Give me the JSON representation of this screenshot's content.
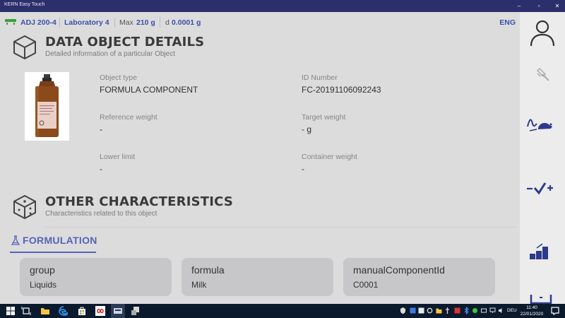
{
  "window": {
    "title": "KERN Easy Touch",
    "minimize": "–",
    "maximize": "▫",
    "close": "✕"
  },
  "status": {
    "balance": "ADJ 200-4",
    "lab": "Laboratory 4",
    "max_label": "Max",
    "max_value": "210 g",
    "d_label": "d",
    "d_value": "0.0001 g",
    "language": "ENG"
  },
  "details": {
    "title": "DATA OBJECT DETAILS",
    "subtitle": "Detailed information of a particular Object",
    "fields": [
      {
        "label": "Object type",
        "value": "FORMULA COMPONENT"
      },
      {
        "label": "ID Number",
        "value": "FC-20191106092243"
      },
      {
        "label": "Reference weight",
        "value": "-"
      },
      {
        "label": "Target weight",
        "value": "- g"
      },
      {
        "label": "Lower limit",
        "value": "-"
      },
      {
        "label": "Container weight",
        "value": "-"
      }
    ]
  },
  "other": {
    "title": "OTHER CHARACTERISTICS",
    "subtitle": "Characteristics related to this object"
  },
  "tab": {
    "label": "FORMULATION",
    "icon": "flask-icon"
  },
  "cards": [
    {
      "key": "group",
      "value": "Liquids"
    },
    {
      "key": "formula",
      "value": "Milk"
    },
    {
      "key": "manualComponentId",
      "value": "C0001"
    }
  ],
  "sidebar": {
    "items": [
      "user-icon",
      "hammer-icon",
      "mouse-curve-icon",
      "minus-check-plus-icon",
      "steps-chart-icon",
      "scale-icon"
    ]
  },
  "taskbar": {
    "language": "DEU",
    "time": "11:40",
    "date": "22/01/2020"
  },
  "colors": {
    "accent": "#5563b8",
    "titlebar": "#2b2f6b",
    "taskbar": "#0c1a2e"
  }
}
